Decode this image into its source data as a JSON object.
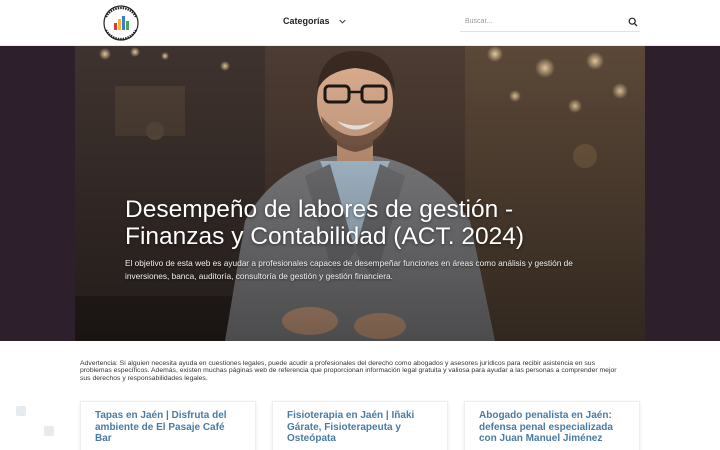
{
  "header": {
    "logo_text": "FINANZAS Y CONTABILIDAD",
    "nav_categories": "Categorías",
    "search_placeholder": "Buscar..."
  },
  "hero": {
    "title": "Desempeño de labores de gestión - Finanzas y Contabilidad (ACT. 2024)",
    "description": "El objetivo de esta web es ayudar a profesionales capaces de desempeñar funciones en áreas como análisis y gestión de inversiones, banca, auditoría, consultoría de gestión y gestión financiera."
  },
  "advisory": {
    "text": "Advertencia: Si alguien necesita ayuda en cuestiones legales, puede acudir a profesionales del derecho como abogados y asesores jurídicos para recibir asistencia en sus problemas específicos. Además, existen muchas páginas web de referencia que proporcionan información legal gratuita y valiosa para ayudar a las personas a comprender mejor sus derechos y responsabilidades legales."
  },
  "cards": [
    {
      "title": "Tapas en Jaén | Disfruta del ambiente de El Pasaje Café Bar"
    },
    {
      "title": "Fisioterapia en Jaén | Iñaki Gárate, Fisioterapeuta y Osteópata"
    },
    {
      "title": "Abogado penalista en Jaén: defensa penal especializada con Juan Manuel Jiménez"
    }
  ],
  "colors": {
    "hero_background": "#2e1f2d",
    "card_title": "#4a7ca3"
  }
}
